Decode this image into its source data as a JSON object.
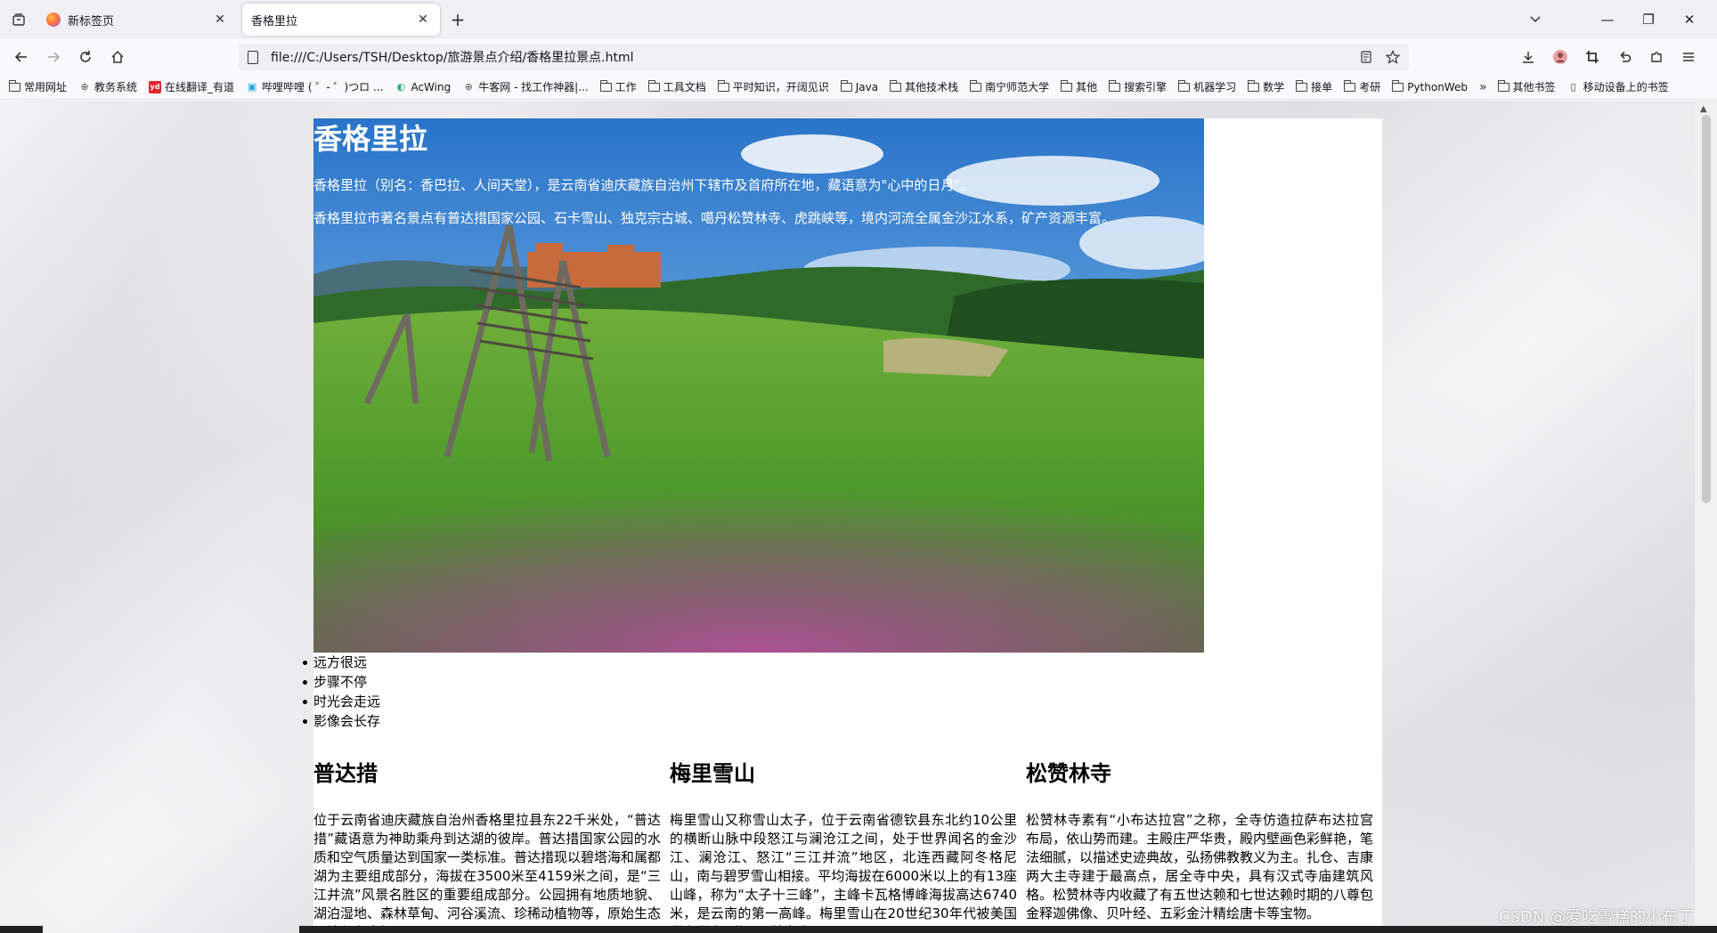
{
  "tabs": {
    "list_all_icon": "tab-list-icon",
    "items": [
      {
        "title": "新标签页",
        "active": false
      },
      {
        "title": "香格里拉",
        "active": true
      }
    ],
    "new_tab_icon": "+"
  },
  "window_controls": {
    "minimize": "—",
    "restore": "❐",
    "close": "✕"
  },
  "navbar": {
    "url": "file:///C:/Users/TSH/Desktop/旅游景点介绍/香格里拉景点.html"
  },
  "bookmarks": [
    {
      "label": "常用网址",
      "icon": "folder"
    },
    {
      "label": "教务系统",
      "icon": "globe"
    },
    {
      "label": "在线翻译_有道",
      "icon": "youdao"
    },
    {
      "label": "哔哩哔哩 ( ゜- ゜)つロ ...",
      "icon": "bilibili"
    },
    {
      "label": "AcWing",
      "icon": "acwing"
    },
    {
      "label": "牛客网 - 找工作神器|...",
      "icon": "globe"
    },
    {
      "label": "工作",
      "icon": "folder"
    },
    {
      "label": "工具文档",
      "icon": "folder"
    },
    {
      "label": "平时知识，开阔见识",
      "icon": "folder"
    },
    {
      "label": "Java",
      "icon": "folder"
    },
    {
      "label": "其他技术栈",
      "icon": "folder"
    },
    {
      "label": "南宁师范大学",
      "icon": "folder"
    },
    {
      "label": "其他",
      "icon": "folder"
    },
    {
      "label": "搜索引擎",
      "icon": "folder"
    },
    {
      "label": "机器学习",
      "icon": "folder"
    },
    {
      "label": "数学",
      "icon": "folder"
    },
    {
      "label": "接单",
      "icon": "folder"
    },
    {
      "label": "考研",
      "icon": "folder"
    },
    {
      "label": "PythonWeb",
      "icon": "folder"
    }
  ],
  "bookmarks_overflow": "»",
  "bookmarks_right": [
    {
      "label": "其他书签",
      "icon": "folder"
    },
    {
      "label": "移动设备上的书签",
      "icon": "mobile"
    }
  ],
  "page": {
    "title": "香格里拉",
    "intro1": "香格里拉（别名：香巴拉、人间天堂），是云南省迪庆藏族自治州下辖市及首府所在地，藏语意为\"心中的日月\"。",
    "intro2": "香格里拉市著名景点有普达措国家公园、石卡雪山、独克宗古城、噶丹松赞林寺、虎跳峡等，境内河流全属金沙江水系，矿产资源丰富。",
    "bullets": [
      "远方很远",
      "步骤不停",
      "时光会走远",
      "影像会长存"
    ],
    "sections": [
      {
        "heading": "普达措",
        "text": "位于云南省迪庆藏族自治州香格里拉县东22千米处，“普达措”藏语意为神助乘舟到达湖的彼岸。普达措国家公园的水质和空气质量达到国家一类标准。普达措现以碧塔海和属都湖为主要组成部分，海拔在3500米至4159米之间，是“三江并流”风景名胜区的重要组成部分。公园拥有地质地貌、湖泊湿地、森林草甸、河谷溪流、珍稀动植物等，原始生态环境保存完好。"
      },
      {
        "heading": "梅里雪山",
        "text": "梅里雪山又称雪山太子，位于云南省德钦县东北约10公里的横断山脉中段怒江与澜沧江之间，处于世界闻名的金沙江、澜沧江、怒江“三江并流”地区，北连西藏阿冬格尼山，南与碧罗雪山相接。平均海拔在6000米以上的有13座山峰，称为“太子十三峰”，主峰卡瓦格博峰海拔高达6740米，是云南的第一高峰。梅里雪山在20世纪30年代被美国学者誉为“世界最美之山”。"
      },
      {
        "heading": "松赞林寺",
        "text": "松赞林寺素有“小布达拉宫”之称，全寺仿造拉萨布达拉宫布局，依山势而建。主殿庄严华贵，殿内壁画色彩鲜艳，笔法细腻，以描述史迹典故，弘扬佛教教义为主。扎仓、吉康两大主寺建于最高点，居全寺中央，具有汉式寺庙建筑风格。松赞林寺内收藏了有五世达赖和七世达赖时期的八尊包金释迦佛像、贝叶经、五彩金汁精绘唐卡等宝物。"
      }
    ]
  },
  "watermark": "CSDN @爱吃雪糕的小布丁",
  "colors": {
    "accent": "#ff7139",
    "page_bg": "#ffffff"
  }
}
